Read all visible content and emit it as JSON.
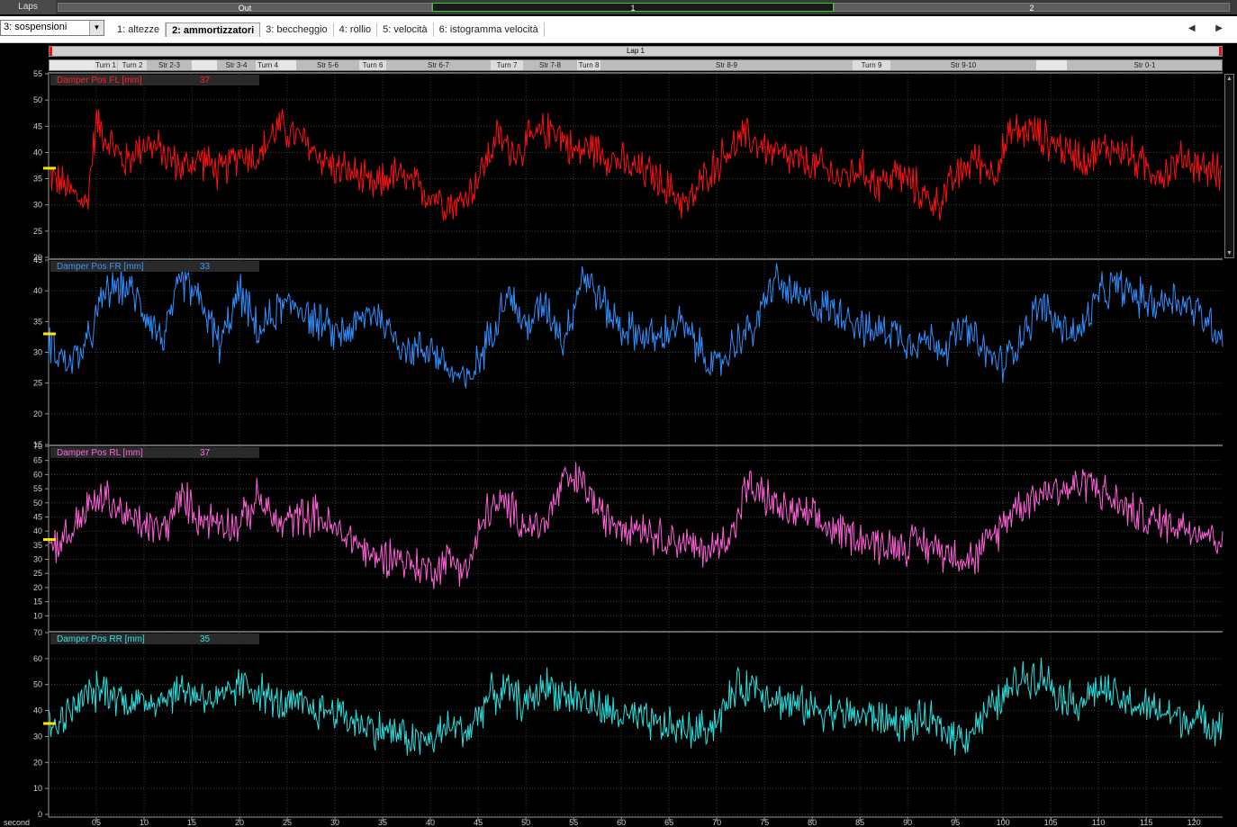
{
  "laps": {
    "label": "Laps",
    "segments": [
      {
        "label": "Out",
        "active": false
      },
      {
        "label": "1",
        "active": true
      },
      {
        "label": "2",
        "active": false
      }
    ],
    "nav": "◀ ▶"
  },
  "toolbar": {
    "page_select": "3: sospensioni",
    "dropdown_arrow": "▼",
    "tabs": [
      {
        "label": "1: altezze",
        "active": false
      },
      {
        "label": "2: ammortizzatori",
        "active": true
      },
      {
        "label": "3: beccheggio",
        "active": false
      },
      {
        "label": "4: rollio",
        "active": false
      },
      {
        "label": "5: velocità",
        "active": false
      },
      {
        "label": "6: istogramma velocità",
        "active": false
      }
    ],
    "arrows": "◀ ▶"
  },
  "lap_header": "Lap 1",
  "segments": [
    {
      "label": "",
      "kind": "blank",
      "start": 54,
      "end": 104
    },
    {
      "label": "Turn 1",
      "kind": "turn",
      "start": 104,
      "end": 129
    },
    {
      "label": "Turn 2",
      "kind": "turn",
      "start": 130,
      "end": 162
    },
    {
      "label": "Str 2-3",
      "kind": "straight",
      "start": 162,
      "end": 212
    },
    {
      "label": "",
      "kind": "blank",
      "start": 212,
      "end": 240
    },
    {
      "label": "Str 3-4",
      "kind": "straight",
      "start": 240,
      "end": 283
    },
    {
      "label": "Turn 4",
      "kind": "turn",
      "start": 283,
      "end": 310
    },
    {
      "label": "",
      "kind": "blank",
      "start": 310,
      "end": 328
    },
    {
      "label": "Str 5-6",
      "kind": "straight",
      "start": 328,
      "end": 398
    },
    {
      "label": "Turn 6",
      "kind": "turn",
      "start": 398,
      "end": 428
    },
    {
      "label": "Str 6-7",
      "kind": "straight",
      "start": 428,
      "end": 544
    },
    {
      "label": "Turn 7",
      "kind": "turn",
      "start": 544,
      "end": 580
    },
    {
      "label": "Str 7-8",
      "kind": "straight",
      "start": 580,
      "end": 640
    },
    {
      "label": "Turn 8",
      "kind": "turn",
      "start": 640,
      "end": 666
    },
    {
      "label": "Str 8-9",
      "kind": "straight",
      "start": 666,
      "end": 946
    },
    {
      "label": "Turn 9",
      "kind": "turn",
      "start": 946,
      "end": 988
    },
    {
      "label": "Str 9-10",
      "kind": "straight",
      "start": 988,
      "end": 1150
    },
    {
      "label": "",
      "kind": "blank",
      "start": 1150,
      "end": 1184
    },
    {
      "label": "Str 0-1",
      "kind": "straight",
      "start": 1184,
      "end": 1357
    }
  ],
  "x_axis": {
    "unit": "second",
    "ticks": [
      "05",
      "10",
      "15",
      "20",
      "25",
      "30",
      "35",
      "40",
      "45",
      "50",
      "55",
      "60",
      "65",
      "70",
      "75",
      "80",
      "85",
      "90",
      "95",
      "100",
      "105",
      "110",
      "115",
      "120"
    ]
  },
  "channels": [
    {
      "name": "Damper Pos FL [mm]",
      "value": "37",
      "color": "#ff1010",
      "label_color": "#ff2222",
      "ylim": [
        20,
        55
      ],
      "yticks": [
        20,
        25,
        30,
        35,
        40,
        45,
        50,
        55
      ],
      "marker": 37,
      "trace": [
        [
          0,
          36
        ],
        [
          2,
          33
        ],
        [
          4,
          30
        ],
        [
          5,
          46
        ],
        [
          6,
          43
        ],
        [
          8,
          38
        ],
        [
          10,
          42
        ],
        [
          12,
          40
        ],
        [
          14,
          37
        ],
        [
          16,
          39
        ],
        [
          18,
          36
        ],
        [
          20,
          40
        ],
        [
          22,
          39
        ],
        [
          24,
          45
        ],
        [
          26,
          43
        ],
        [
          28,
          40
        ],
        [
          30,
          37
        ],
        [
          32,
          36
        ],
        [
          34,
          33
        ],
        [
          36,
          36
        ],
        [
          38,
          34
        ],
        [
          40,
          32
        ],
        [
          43,
          30
        ],
        [
          45,
          35
        ],
        [
          47,
          43
        ],
        [
          49,
          40
        ],
        [
          51,
          43
        ],
        [
          53,
          45
        ],
        [
          55,
          40
        ],
        [
          57,
          41
        ],
        [
          59,
          39
        ],
        [
          61,
          37
        ],
        [
          63,
          36
        ],
        [
          65,
          33
        ],
        [
          67,
          30
        ],
        [
          69,
          36
        ],
        [
          71,
          40
        ],
        [
          73,
          43
        ],
        [
          75,
          41
        ],
        [
          77,
          39
        ],
        [
          79,
          38
        ],
        [
          81,
          37
        ],
        [
          83,
          35
        ],
        [
          85,
          37
        ],
        [
          87,
          34
        ],
        [
          89,
          36
        ],
        [
          91,
          33
        ],
        [
          93,
          30
        ],
        [
          95,
          35
        ],
        [
          97,
          39
        ],
        [
          99,
          36
        ],
        [
          101,
          44
        ],
        [
          103,
          44
        ],
        [
          105,
          42
        ],
        [
          107,
          40
        ],
        [
          109,
          39
        ],
        [
          111,
          41
        ],
        [
          113,
          40
        ],
        [
          115,
          37
        ],
        [
          117,
          36
        ],
        [
          119,
          39
        ],
        [
          121,
          37
        ],
        [
          123,
          36
        ]
      ]
    },
    {
      "name": "Damper Pos FR [mm]",
      "value": "33",
      "color": "#2f8fff",
      "label_color": "#3a96ff",
      "ylim": [
        15,
        45
      ],
      "yticks": [
        15,
        20,
        25,
        30,
        35,
        40,
        45
      ],
      "marker": 33,
      "trace": [
        [
          0,
          32
        ],
        [
          2,
          28
        ],
        [
          4,
          31
        ],
        [
          6,
          40
        ],
        [
          8,
          41
        ],
        [
          10,
          37
        ],
        [
          12,
          32
        ],
        [
          14,
          42
        ],
        [
          16,
          38
        ],
        [
          18,
          31
        ],
        [
          20,
          40
        ],
        [
          22,
          33
        ],
        [
          24,
          37
        ],
        [
          26,
          38
        ],
        [
          28,
          35
        ],
        [
          30,
          33
        ],
        [
          32,
          34
        ],
        [
          34,
          37
        ],
        [
          36,
          33
        ],
        [
          38,
          30
        ],
        [
          40,
          31
        ],
        [
          42,
          27
        ],
        [
          44,
          25
        ],
        [
          46,
          32
        ],
        [
          48,
          40
        ],
        [
          50,
          34
        ],
        [
          52,
          38
        ],
        [
          54,
          32
        ],
        [
          56,
          43
        ],
        [
          58,
          38
        ],
        [
          60,
          34
        ],
        [
          62,
          33
        ],
        [
          64,
          32
        ],
        [
          66,
          35
        ],
        [
          68,
          31
        ],
        [
          70,
          27
        ],
        [
          72,
          32
        ],
        [
          74,
          34
        ],
        [
          76,
          42
        ],
        [
          78,
          39
        ],
        [
          80,
          38
        ],
        [
          82,
          37
        ],
        [
          84,
          36
        ],
        [
          86,
          33
        ],
        [
          88,
          34
        ],
        [
          90,
          32
        ],
        [
          92,
          32
        ],
        [
          94,
          31
        ],
        [
          96,
          34
        ],
        [
          98,
          30
        ],
        [
          100,
          28
        ],
        [
          102,
          33
        ],
        [
          104,
          38
        ],
        [
          106,
          34
        ],
        [
          108,
          33
        ],
        [
          110,
          39
        ],
        [
          112,
          41
        ],
        [
          114,
          39
        ],
        [
          116,
          38
        ],
        [
          118,
          39
        ],
        [
          120,
          37
        ],
        [
          123,
          33
        ]
      ]
    },
    {
      "name": "Damper Pos RL [mm]",
      "value": "37",
      "color": "#ff60d8",
      "label_color": "#ff66dd",
      "ylim": [
        5,
        70
      ],
      "yticks": [
        10,
        15,
        20,
        25,
        30,
        35,
        40,
        45,
        50,
        55,
        60,
        65,
        70
      ],
      "marker": 37,
      "trace": [
        [
          0,
          35
        ],
        [
          2,
          38
        ],
        [
          4,
          48
        ],
        [
          6,
          52
        ],
        [
          8,
          45
        ],
        [
          10,
          42
        ],
        [
          12,
          40
        ],
        [
          14,
          52
        ],
        [
          16,
          44
        ],
        [
          18,
          44
        ],
        [
          20,
          42
        ],
        [
          22,
          52
        ],
        [
          24,
          42
        ],
        [
          26,
          45
        ],
        [
          28,
          46
        ],
        [
          30,
          40
        ],
        [
          32,
          37
        ],
        [
          34,
          30
        ],
        [
          36,
          32
        ],
        [
          38,
          28
        ],
        [
          40,
          26
        ],
        [
          42,
          30
        ],
        [
          44,
          27
        ],
        [
          46,
          48
        ],
        [
          48,
          49
        ],
        [
          50,
          42
        ],
        [
          52,
          42
        ],
        [
          54,
          58
        ],
        [
          56,
          57
        ],
        [
          58,
          45
        ],
        [
          60,
          43
        ],
        [
          62,
          42
        ],
        [
          64,
          38
        ],
        [
          66,
          37
        ],
        [
          68,
          33
        ],
        [
          70,
          34
        ],
        [
          72,
          42
        ],
        [
          73,
          56
        ],
        [
          75,
          52
        ],
        [
          77,
          47
        ],
        [
          79,
          46
        ],
        [
          81,
          42
        ],
        [
          83,
          40
        ],
        [
          85,
          38
        ],
        [
          87,
          35
        ],
        [
          89,
          35
        ],
        [
          91,
          36
        ],
        [
          93,
          34
        ],
        [
          95,
          32
        ],
        [
          97,
          30
        ],
        [
          99,
          38
        ],
        [
          101,
          48
        ],
        [
          103,
          52
        ],
        [
          105,
          55
        ],
        [
          107,
          55
        ],
        [
          109,
          58
        ],
        [
          111,
          52
        ],
        [
          113,
          48
        ],
        [
          115,
          44
        ],
        [
          117,
          43
        ],
        [
          119,
          42
        ],
        [
          121,
          40
        ],
        [
          123,
          37
        ]
      ]
    },
    {
      "name": "Damper Pos RR [mm]",
      "value": "35",
      "color": "#29e0e0",
      "label_color": "#2ee6e6",
      "ylim": [
        0,
        70
      ],
      "yticks": [
        0,
        10,
        20,
        30,
        40,
        50,
        60,
        70
      ],
      "marker": 35,
      "trace": [
        [
          0,
          33
        ],
        [
          2,
          38
        ],
        [
          4,
          46
        ],
        [
          6,
          48
        ],
        [
          8,
          44
        ],
        [
          10,
          43
        ],
        [
          12,
          45
        ],
        [
          14,
          48
        ],
        [
          16,
          46
        ],
        [
          18,
          43
        ],
        [
          20,
          50
        ],
        [
          22,
          48
        ],
        [
          24,
          42
        ],
        [
          26,
          42
        ],
        [
          28,
          40
        ],
        [
          30,
          40
        ],
        [
          32,
          36
        ],
        [
          34,
          33
        ],
        [
          36,
          32
        ],
        [
          38,
          29
        ],
        [
          40,
          28
        ],
        [
          42,
          34
        ],
        [
          44,
          32
        ],
        [
          46,
          45
        ],
        [
          48,
          48
        ],
        [
          50,
          42
        ],
        [
          52,
          50
        ],
        [
          54,
          46
        ],
        [
          56,
          44
        ],
        [
          58,
          40
        ],
        [
          60,
          38
        ],
        [
          62,
          36
        ],
        [
          64,
          34
        ],
        [
          66,
          33
        ],
        [
          68,
          32
        ],
        [
          70,
          36
        ],
        [
          72,
          48
        ],
        [
          74,
          50
        ],
        [
          76,
          45
        ],
        [
          78,
          42
        ],
        [
          80,
          41
        ],
        [
          82,
          40
        ],
        [
          84,
          38
        ],
        [
          86,
          38
        ],
        [
          88,
          36
        ],
        [
          90,
          35
        ],
        [
          92,
          36
        ],
        [
          94,
          32
        ],
        [
          96,
          30
        ],
        [
          98,
          38
        ],
        [
          100,
          45
        ],
        [
          102,
          53
        ],
        [
          104,
          54
        ],
        [
          106,
          46
        ],
        [
          108,
          43
        ],
        [
          110,
          49
        ],
        [
          112,
          44
        ],
        [
          114,
          42
        ],
        [
          116,
          40
        ],
        [
          118,
          38
        ],
        [
          120,
          36
        ],
        [
          123,
          35
        ]
      ]
    }
  ]
}
